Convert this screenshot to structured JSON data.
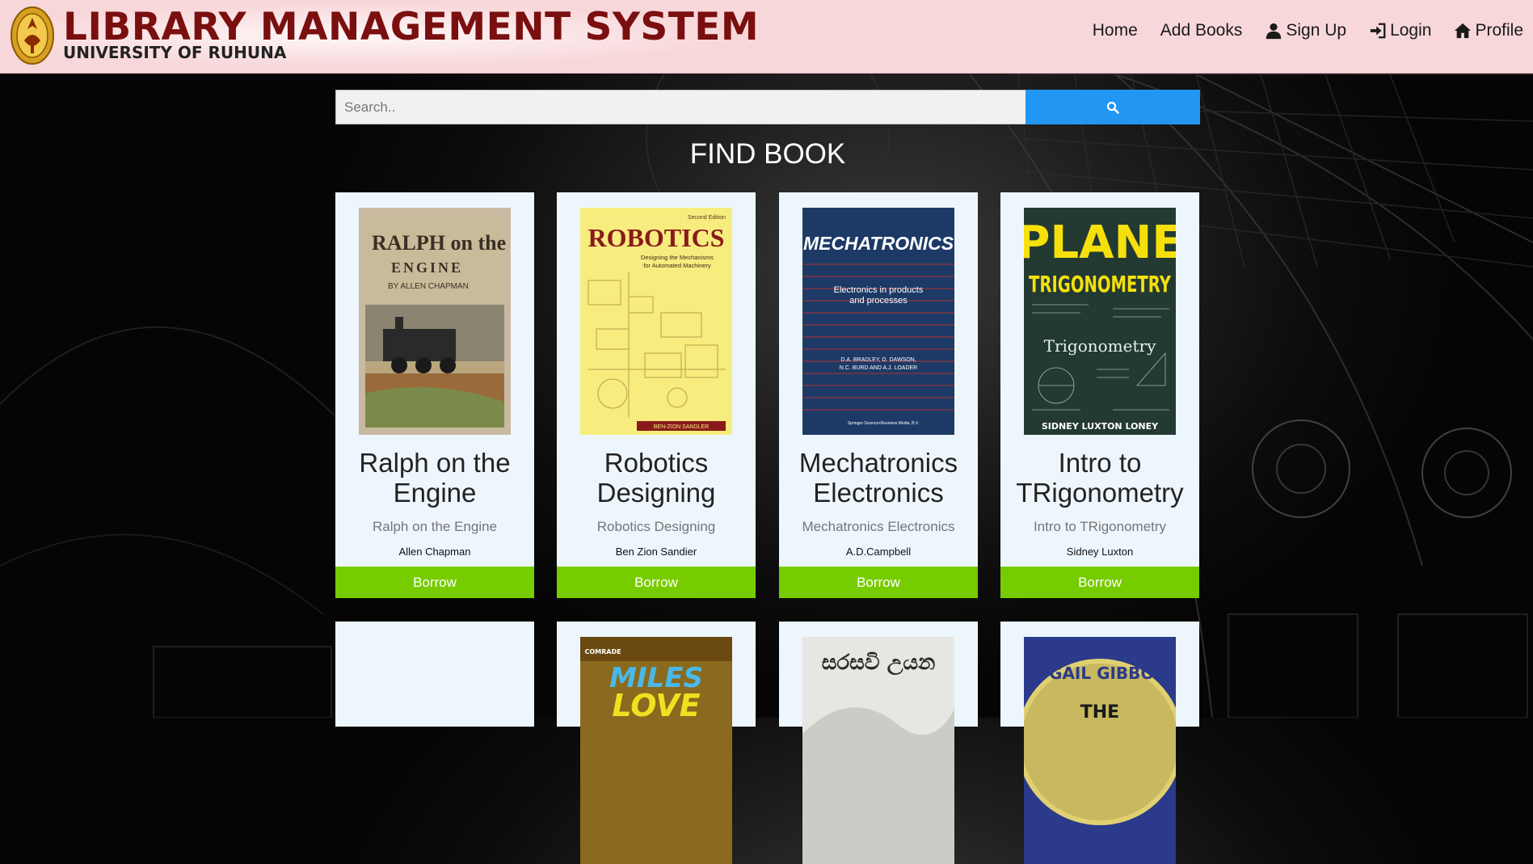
{
  "header": {
    "title": "LIBRARY MANAGEMENT SYSTEM",
    "subtitle": "UNIVERSITY OF RUHUNA",
    "seal_icon": "university-seal-logo"
  },
  "nav": {
    "home": "Home",
    "add_books": "Add Books",
    "sign_up": "Sign Up",
    "login": "Login",
    "profile": "Profile",
    "sign_up_icon": "user-icon",
    "login_icon": "login-icon",
    "profile_icon": "home-icon"
  },
  "search": {
    "placeholder": "Search..",
    "value": "",
    "button_icon": "search-icon"
  },
  "page_heading": "FIND BOOK",
  "books": [
    {
      "title": "Ralph on the Engine",
      "subtitle": "Ralph on the Engine",
      "author": "Allen Chapman",
      "action": "Borrow"
    },
    {
      "title": "Robotics Designing",
      "subtitle": "Robotics Designing",
      "author": "Ben Zion Sandier",
      "action": "Borrow"
    },
    {
      "title": "Mechatronics Electronics",
      "subtitle": "Mechatronics Electronics",
      "author": "A.D.Campbell",
      "action": "Borrow"
    },
    {
      "title": "Intro to TRigonometry",
      "subtitle": "Intro to TRigonometry",
      "author": "Sidney Luxton",
      "action": "Borrow"
    }
  ],
  "covers": {
    "ralph": {
      "line1": "RALPH on the",
      "line2": "ENGINE",
      "line3": "BY ALLEN CHAPMAN"
    },
    "robotics": {
      "edition": "Second Edition",
      "title": "ROBOTICS",
      "sub1": "Designing the Mechanisms",
      "sub2": "for Automated Machinery",
      "author": "BEN-ZION SANDLER"
    },
    "mechatronics": {
      "title": "MECHATRONICS",
      "sub1": "Electronics in products",
      "sub2": "and processes",
      "authors1": "D.A. BRADLEY, D. DAWSON,",
      "authors2": "N.C. BURD AND A.J. LOADER",
      "publisher": "Springer-Science+Business Media, B.V."
    },
    "trig": {
      "title1": "PLANE",
      "title2": "TRIGONOMETRY",
      "chalk": "Trigonometry",
      "author": "SIDNEY LUXTON LONEY"
    },
    "miles": {
      "brand": "COMRADE",
      "title1": "MILES",
      "title2": "LOVE"
    },
    "sinhala": {
      "title": "සරසවි උයන"
    },
    "gibbons": {
      "author": "BY GAIL GIBBONS",
      "title": "THE"
    }
  },
  "colors": {
    "header_bg": "#f8d7da",
    "title_color": "#7a0f0f",
    "search_button": "#2196f3",
    "borrow_button": "#77cc00",
    "card_bg": "#eef6fd"
  }
}
